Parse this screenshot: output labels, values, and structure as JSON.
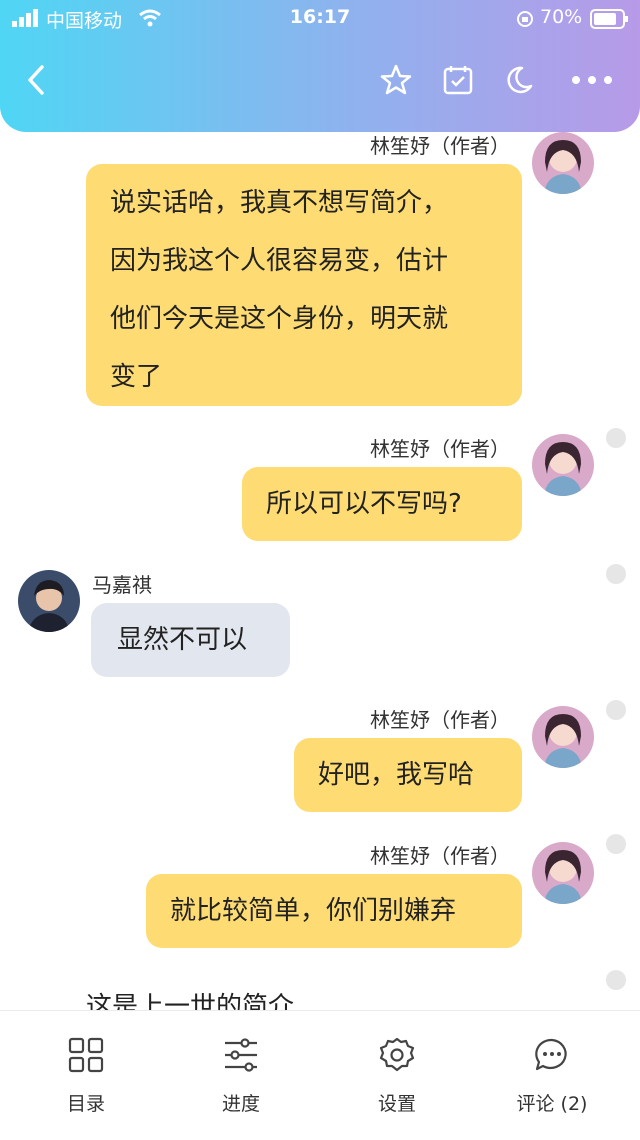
{
  "status_bar": {
    "carrier": "中国移动",
    "time": "16:17",
    "battery": "70%"
  },
  "header": {
    "back_icon": "chevron-left-icon",
    "star_icon": "star-icon",
    "calendar_icon": "calendar-check-icon",
    "night_icon": "moon-icon",
    "more_icon": "more-dots-icon"
  },
  "messages": [
    {
      "author": "林笙妤（作者）",
      "lines": [
        "说实话哈，我真不想写简介，",
        "因为我这个人很容易变，估计",
        "他们今天是这个身份，明天就",
        "变了"
      ]
    },
    {
      "author": "林笙妤（作者）",
      "text": "所以可以不写吗?"
    },
    {
      "author": "马嘉祺",
      "text": "显然不可以"
    },
    {
      "author": "林笙妤（作者）",
      "text": "好吧，我写哈"
    },
    {
      "author": "林笙妤（作者）",
      "text": "就比较简单，你们别嫌弃"
    }
  ],
  "trailing_text": "这是上一世的简介",
  "bottom_tabs": [
    {
      "label": "目录",
      "icon": "grid-icon"
    },
    {
      "label": "进度",
      "icon": "sliders-icon"
    },
    {
      "label": "设置",
      "icon": "gear-icon"
    },
    {
      "label": "评论 (2)",
      "icon": "comment-icon"
    }
  ],
  "colors": {
    "header_start": "#4fd6f4",
    "header_end": "#b79ae8",
    "author_bubble": "#fedc73",
    "reader_bubble": "#e2e6ee"
  }
}
